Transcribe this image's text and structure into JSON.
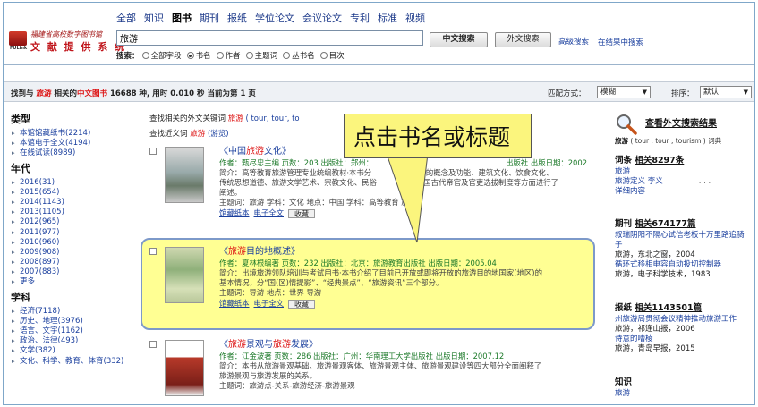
{
  "logo": {
    "line1": "福建省高校数字图书馆",
    "line2": "文 献 提 供 系 统",
    "mark": "FULink"
  },
  "nav": {
    "cats": [
      "全部",
      "知识",
      "图书",
      "期刊",
      "报纸",
      "学位论文",
      "会议论文",
      "专利",
      "标准",
      "视频"
    ],
    "active": "图书"
  },
  "search": {
    "value": "旅游",
    "btn_cn": "中文搜索",
    "btn_en": "外文搜索",
    "advanced": "高级搜索",
    "in_results": "在结果中搜索",
    "fields_label": "搜索：",
    "fields": [
      "全部字段",
      "书名",
      "作者",
      "主题词",
      "丛书名",
      "目次"
    ],
    "selected": "书名"
  },
  "resultbar": {
    "prefix": "找到与",
    "kw": "旅游",
    "mid": "相关的",
    "type": "中文图书",
    "count": "16688",
    "suffix": "种, 用时",
    "time": "0.010",
    "unit": "秒 当前为第 1 页",
    "match_label": "匹配方式：",
    "match_value": "模糊",
    "sort_label": "排序：",
    "sort_value": "默认"
  },
  "sidebar": {
    "type_title": "类型",
    "types": [
      "本馆馆藏纸书(2214)",
      "本馆电子全文(4194)",
      "在线试读(8989)"
    ],
    "year_title": "年代",
    "years": [
      "2016(31)",
      "2015(654)",
      "2014(1143)",
      "2013(1105)",
      "2012(965)",
      "2011(977)",
      "2010(960)",
      "2009(908)",
      "2008(897)",
      "2007(883)",
      "更多"
    ],
    "subject_title": "学科",
    "subjects": [
      "经济(7118)",
      "历史、地理(3976)",
      "语言、文字(1162)",
      "政治、法律(493)",
      "文学(382)",
      "文化、科学、教育、体育(332)"
    ]
  },
  "related": {
    "label": "查找相关的外文关键词",
    "kw": "旅游",
    "terms": "( tour, tour, to"
  },
  "near": {
    "label": "查找近义词",
    "kw": "旅游",
    "extra": "(游览)"
  },
  "callout": "点击书名或标题",
  "records": [
    {
      "title_pre": "《中国",
      "title_hl": "旅游",
      "title_post": "文化》",
      "meta": "作者：甄尽忠主编  页数：203  出版社：郑州：",
      "meta2": "出版社  出版日期：2002",
      "desc": "简介：高等教育旅游管理专业统编教材·本书分",
      "desc2": "文化的概念及功能、建筑文化、饮食文化、",
      "desc3": "传统思想道德、旅游文学艺术、宗教文化、民俗",
      "desc4": "中国古代帝官及官吏选拔制度等方面进行了",
      "desc5": "阐述。",
      "subj": "主题词：旅游 学科：文化 地点：中国 学科：高等教育 旅游",
      "links": [
        "馆藏纸本",
        "电子全文"
      ],
      "fav": "收藏"
    },
    {
      "title_pre": "《",
      "title_hl": "旅游",
      "title_post": "目的地概述》",
      "meta": "作者：夏林根编著  页数：232  出版社：北京：旅游教育出版社  出版日期：2005.04",
      "desc": "简介：出境旅游领队培训与考试用书·本书介绍了目前已开放或即将开放的旅游目的地国家(地区)的",
      "desc2": "基本情况，分“国(区)情提影”、“经典景点”、“旅游资讯”三个部分。",
      "subj": "主题词：导游 地点：世界 导游",
      "links": [
        "馆藏纸本",
        "电子全文"
      ],
      "fav": "收藏"
    },
    {
      "title_pre": "《",
      "title_hl": "旅游",
      "title_post": "景观与",
      "title_hl2": "旅游",
      "title_post2": "发展》",
      "meta": "作者：江金波著  页数：286  出版社：广州：华南理工大学出版社  出版日期：2007.12",
      "desc": "简介：本书从旅游景观基础、旅游景观客体、旅游景观主体、旅游景观建设等四大部分全面阐释了",
      "desc2": "旅游景观与旅游发展的关系。",
      "subj": "主题词：旅游点-关系-旅游经济-旅游景观"
    }
  ],
  "right": {
    "ext_title": "查看外文搜索结果",
    "ext_sub_kw": "旅游",
    "ext_sub_terms": "( tour , tour , tourism ) 词典",
    "cit_title": "词条",
    "cit_count": "相关8297条",
    "cit_lines": [
      "旅游",
      "旅游定义 李义",
      "详细内容"
    ],
    "journal_title": "期刊",
    "journal_count": "相关674177篇",
    "journal_lines": [
      "叙瑞阴阳不隔心试信老板十万里路追骑",
      "子",
      "旅游，东北之窗，2004",
      "循环式移相电容自动投切控制器",
      "旅游，电子科学技术，1983"
    ],
    "news_title": "报纸",
    "news_count": "相关1143501篇",
    "news_lines": [
      "州旅游局贯彻会议精神推动旅游工作",
      "旅游，祁连山报，2006",
      "诗意的嘈棱",
      "旅游，青岛早报，2015"
    ],
    "know_title": "知识",
    "know_lines": [
      "旅游"
    ]
  }
}
